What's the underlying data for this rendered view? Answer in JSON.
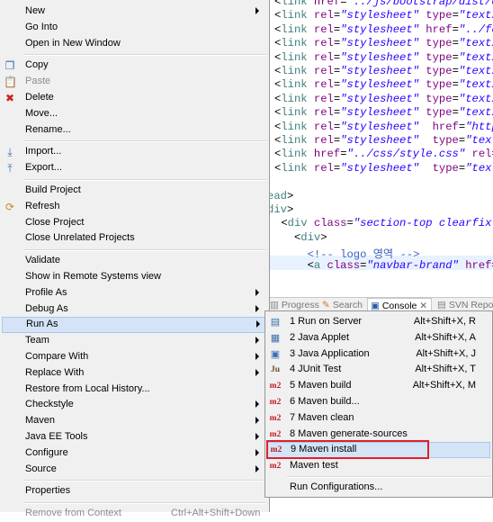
{
  "editor": {
    "lines": [
      {
        "parts": [
          [
            "plain",
            "<"
          ],
          [
            "tag",
            "link"
          ],
          [
            "plain",
            " "
          ],
          [
            "attr",
            "href"
          ],
          [
            "plain",
            "="
          ],
          [
            "val",
            "\"../js/bootstrap/dist/c"
          ]
        ]
      },
      {
        "parts": [
          [
            "plain",
            "<"
          ],
          [
            "tag",
            "link"
          ],
          [
            "plain",
            " "
          ],
          [
            "attr",
            "rel"
          ],
          [
            "plain",
            "="
          ],
          [
            "val",
            "\"stylesheet\""
          ],
          [
            "plain",
            " "
          ],
          [
            "attr",
            "type"
          ],
          [
            "plain",
            "="
          ],
          [
            "val",
            "\"text/"
          ]
        ]
      },
      {
        "parts": [
          [
            "plain",
            "<"
          ],
          [
            "tag",
            "link"
          ],
          [
            "plain",
            " "
          ],
          [
            "attr",
            "rel"
          ],
          [
            "plain",
            "="
          ],
          [
            "val",
            "\"stylesheet\""
          ],
          [
            "plain",
            " "
          ],
          [
            "attr",
            "href"
          ],
          [
            "plain",
            "="
          ],
          [
            "val",
            "\"../fo"
          ]
        ]
      },
      {
        "parts": [
          [
            "plain",
            "<"
          ],
          [
            "tag",
            "link"
          ],
          [
            "plain",
            " "
          ],
          [
            "attr",
            "rel"
          ],
          [
            "plain",
            "="
          ],
          [
            "val",
            "\"stylesheet\""
          ],
          [
            "plain",
            " "
          ],
          [
            "attr",
            "type"
          ],
          [
            "plain",
            "="
          ],
          [
            "val",
            "\"text/"
          ]
        ]
      },
      {
        "parts": [
          [
            "plain",
            "<"
          ],
          [
            "tag",
            "link"
          ],
          [
            "plain",
            " "
          ],
          [
            "attr",
            "rel"
          ],
          [
            "plain",
            "="
          ],
          [
            "val",
            "\"stylesheet\""
          ],
          [
            "plain",
            " "
          ],
          [
            "attr",
            "type"
          ],
          [
            "plain",
            "="
          ],
          [
            "val",
            "\"text/"
          ]
        ]
      },
      {
        "parts": [
          [
            "plain",
            "<"
          ],
          [
            "tag",
            "link"
          ],
          [
            "plain",
            " "
          ],
          [
            "attr",
            "rel"
          ],
          [
            "plain",
            "="
          ],
          [
            "val",
            "\"stylesheet\""
          ],
          [
            "plain",
            " "
          ],
          [
            "attr",
            "type"
          ],
          [
            "plain",
            "="
          ],
          [
            "val",
            "\"text/"
          ]
        ]
      },
      {
        "parts": [
          [
            "plain",
            "<"
          ],
          [
            "tag",
            "link"
          ],
          [
            "plain",
            " "
          ],
          [
            "attr",
            "rel"
          ],
          [
            "plain",
            "="
          ],
          [
            "val",
            "\"stylesheet\""
          ],
          [
            "plain",
            " "
          ],
          [
            "attr",
            "type"
          ],
          [
            "plain",
            "="
          ],
          [
            "val",
            "\"text/"
          ]
        ]
      },
      {
        "parts": [
          [
            "plain",
            "<"
          ],
          [
            "tag",
            "link"
          ],
          [
            "plain",
            " "
          ],
          [
            "attr",
            "rel"
          ],
          [
            "plain",
            "="
          ],
          [
            "val",
            "\"stylesheet\""
          ],
          [
            "plain",
            " "
          ],
          [
            "attr",
            "type"
          ],
          [
            "plain",
            "="
          ],
          [
            "val",
            "\"text/"
          ]
        ]
      },
      {
        "parts": [
          [
            "plain",
            "<"
          ],
          [
            "tag",
            "link"
          ],
          [
            "plain",
            " "
          ],
          [
            "attr",
            "rel"
          ],
          [
            "plain",
            "="
          ],
          [
            "val",
            "\"stylesheet\""
          ],
          [
            "plain",
            " "
          ],
          [
            "attr",
            "type"
          ],
          [
            "plain",
            "="
          ],
          [
            "val",
            "\"text/"
          ]
        ]
      },
      {
        "parts": [
          [
            "plain",
            "<"
          ],
          [
            "tag",
            "link"
          ],
          [
            "plain",
            " "
          ],
          [
            "attr",
            "rel"
          ],
          [
            "plain",
            "="
          ],
          [
            "val",
            "\"stylesheet\""
          ],
          [
            "plain",
            "  "
          ],
          [
            "attr",
            "href"
          ],
          [
            "plain",
            "="
          ],
          [
            "val",
            "\"http"
          ]
        ]
      },
      {
        "parts": [
          [
            "plain",
            "<"
          ],
          [
            "tag",
            "link"
          ],
          [
            "plain",
            " "
          ],
          [
            "attr",
            "rel"
          ],
          [
            "plain",
            "="
          ],
          [
            "val",
            "\"stylesheet\""
          ],
          [
            "plain",
            "  "
          ],
          [
            "attr",
            "type"
          ],
          [
            "plain",
            "="
          ],
          [
            "val",
            "\"text"
          ]
        ]
      },
      {
        "parts": [
          [
            "plain",
            "<"
          ],
          [
            "tag",
            "link"
          ],
          [
            "plain",
            " "
          ],
          [
            "attr",
            "href"
          ],
          [
            "plain",
            "="
          ],
          [
            "val",
            "\"../css/style.css\""
          ],
          [
            "plain",
            " "
          ],
          [
            "attr",
            "rel"
          ],
          [
            "plain",
            "="
          ]
        ]
      },
      {
        "parts": [
          [
            "plain",
            "<"
          ],
          [
            "tag",
            "link"
          ],
          [
            "plain",
            " "
          ],
          [
            "attr",
            "rel"
          ],
          [
            "plain",
            "="
          ],
          [
            "val",
            "\"stylesheet\""
          ],
          [
            "plain",
            "  "
          ],
          [
            "attr",
            "type"
          ],
          [
            "plain",
            "="
          ],
          [
            "val",
            "\"text"
          ]
        ]
      },
      {
        "parts": []
      },
      {
        "parts": [
          [
            "tag",
            "ead"
          ],
          [
            "plain",
            ">"
          ]
        ]
      },
      {
        "parts": [
          [
            "tag",
            "div"
          ],
          [
            "plain",
            ">"
          ]
        ]
      },
      {
        "parts": [
          [
            "plain",
            " <"
          ],
          [
            "tag",
            "div"
          ],
          [
            "plain",
            " "
          ],
          [
            "attr",
            "class"
          ],
          [
            "plain",
            "="
          ],
          [
            "val",
            "\"section-top clearfix\""
          ],
          [
            "plain",
            ">"
          ]
        ]
      },
      {
        "parts": [
          [
            "plain",
            "   <"
          ],
          [
            "tag",
            "div"
          ],
          [
            "plain",
            ">"
          ]
        ]
      },
      {
        "parts": [
          [
            "plain",
            "     "
          ],
          [
            "cmt",
            "<!-- logo 영역 -->"
          ]
        ]
      },
      {
        "parts": [
          [
            "plain",
            "     <"
          ],
          [
            "tag",
            "a"
          ],
          [
            "plain",
            " "
          ],
          [
            "attr",
            "class"
          ],
          [
            "plain",
            "="
          ],
          [
            "val",
            "\"navbar-brand\""
          ],
          [
            "plain",
            " "
          ],
          [
            "attr",
            "href"
          ],
          [
            "plain",
            "="
          ],
          [
            "val",
            "\""
          ]
        ]
      }
    ]
  },
  "views_tabs": {
    "progress": "Progress",
    "search": "Search",
    "console": "Console",
    "svn": "SVN Reposi"
  },
  "context_menu": {
    "items": [
      {
        "label": "New",
        "arrow": true,
        "icon": ""
      },
      {
        "label": "Go Into",
        "icon": ""
      },
      {
        "label": "Open in New Window",
        "icon": ""
      },
      {
        "sep": true
      },
      {
        "label": "Copy",
        "icon": "copy-icon"
      },
      {
        "label": "Paste",
        "icon": "paste-icon",
        "disabled": true
      },
      {
        "label": "Delete",
        "icon": "delete-icon"
      },
      {
        "label": "Move...",
        "icon": ""
      },
      {
        "label": "Rename...",
        "icon": ""
      },
      {
        "sep": true
      },
      {
        "label": "Import...",
        "icon": "import-icon"
      },
      {
        "label": "Export...",
        "icon": "export-icon"
      },
      {
        "sep": true
      },
      {
        "label": "Build Project",
        "icon": ""
      },
      {
        "label": "Refresh",
        "icon": "refresh-icon"
      },
      {
        "label": "Close Project",
        "icon": ""
      },
      {
        "label": "Close Unrelated Projects",
        "icon": ""
      },
      {
        "sep": true
      },
      {
        "label": "Validate",
        "icon": ""
      },
      {
        "label": "Show in Remote Systems view",
        "icon": ""
      },
      {
        "label": "Profile As",
        "arrow": true,
        "icon": ""
      },
      {
        "label": "Debug As",
        "arrow": true,
        "icon": ""
      },
      {
        "label": "Run As",
        "arrow": true,
        "icon": "",
        "highlighted": true
      },
      {
        "label": "Team",
        "arrow": true,
        "icon": ""
      },
      {
        "label": "Compare With",
        "arrow": true,
        "icon": ""
      },
      {
        "label": "Replace With",
        "arrow": true,
        "icon": ""
      },
      {
        "label": "Restore from Local History...",
        "icon": ""
      },
      {
        "label": "Checkstyle",
        "arrow": true,
        "icon": ""
      },
      {
        "label": "Maven",
        "arrow": true,
        "icon": ""
      },
      {
        "label": "Java EE Tools",
        "arrow": true,
        "icon": ""
      },
      {
        "label": "Configure",
        "arrow": true,
        "icon": ""
      },
      {
        "label": "Source",
        "arrow": true,
        "icon": ""
      },
      {
        "sep": true
      },
      {
        "label": "Properties",
        "icon": ""
      },
      {
        "sep": true
      },
      {
        "label": "Remove from Context",
        "icon": "",
        "disabled": true,
        "shortcut": "Ctrl+Alt+Shift+Down"
      }
    ]
  },
  "run_as_menu": {
    "items": [
      {
        "label": "1 Run on Server",
        "shortcut": "Alt+Shift+X, R",
        "icon": "server-icon"
      },
      {
        "label": "2 Java Applet",
        "shortcut": "Alt+Shift+X, A",
        "icon": "applet-icon"
      },
      {
        "label": "3 Java Application",
        "shortcut": "Alt+Shift+X, J",
        "icon": "java-app-icon"
      },
      {
        "label": "4 JUnit Test",
        "shortcut": "Alt+Shift+X, T",
        "icon": "junit-icon",
        "icon_text": "Ju"
      },
      {
        "label": "5 Maven build",
        "shortcut": "Alt+Shift+X, M",
        "icon": "maven-icon",
        "icon_text": "m2"
      },
      {
        "label": "6 Maven build...",
        "shortcut": "",
        "icon": "maven-icon",
        "icon_text": "m2"
      },
      {
        "label": "7 Maven clean",
        "shortcut": "",
        "icon": "maven-icon",
        "icon_text": "m2"
      },
      {
        "label": "8 Maven generate-sources",
        "shortcut": "",
        "icon": "maven-icon",
        "icon_text": "m2"
      },
      {
        "label": "9 Maven install",
        "shortcut": "",
        "icon": "maven-icon",
        "icon_text": "m2",
        "highlighted": true
      },
      {
        "label": "Maven test",
        "shortcut": "",
        "icon": "maven-icon",
        "icon_text": "m2"
      },
      {
        "sep": true
      },
      {
        "label": "Run Configurations...",
        "shortcut": "",
        "icon": ""
      }
    ]
  }
}
